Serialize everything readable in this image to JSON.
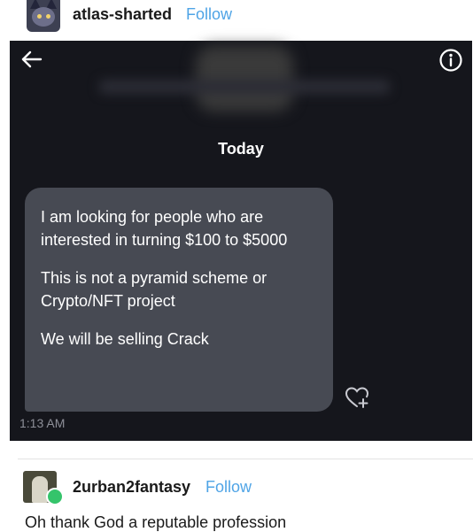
{
  "post": {
    "username": "atlas-sharted",
    "follow_label": "Follow"
  },
  "dm": {
    "date_label": "Today",
    "message_lines": [
      "I am looking for people who are interested in turning $100 to $5000",
      "This is not a pyramid scheme or Crypto/NFT project",
      "We will be selling Crack"
    ],
    "timestamp": "1:13 AM",
    "icons": {
      "back": "back-arrow-icon",
      "info": "info-icon",
      "react": "heart-plus-icon"
    }
  },
  "reply": {
    "username": "2urban2fantasy",
    "follow_label": "Follow",
    "text": "Oh thank God a reputable profession"
  },
  "colors": {
    "dm_background": "#15161c",
    "bubble": "#474a53",
    "follow": "#4fa4e6",
    "reblog_badge": "#35c46b"
  }
}
